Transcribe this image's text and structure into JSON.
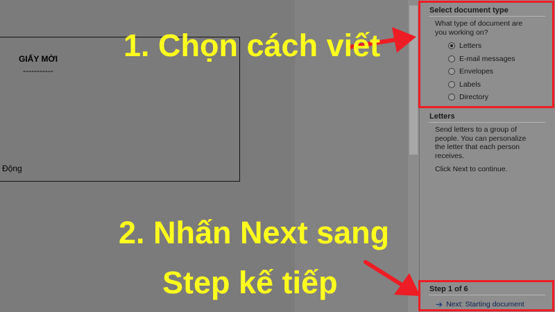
{
  "document": {
    "title": "GIẤY MỜI",
    "dashes": "-----------",
    "footer_fragment": "Động"
  },
  "pane": {
    "select_section": {
      "title": "Select document type",
      "question_line1": "What type of document are",
      "question_line2": "you working on?",
      "options": [
        {
          "label": "Letters",
          "checked": true
        },
        {
          "label": "E-mail messages",
          "checked": false
        },
        {
          "label": "Envelopes",
          "checked": false
        },
        {
          "label": "Labels",
          "checked": false
        },
        {
          "label": "Directory",
          "checked": false
        }
      ]
    },
    "letters_section": {
      "title": "Letters",
      "desc_line1": "Send letters to a group of",
      "desc_line2": "people. You can personalize",
      "desc_line3": "the letter that each person",
      "desc_line4": "receives.",
      "hint": "Click Next to continue."
    },
    "step_section": {
      "title": "Step 1 of 6",
      "next_label": "Next: Starting document"
    }
  },
  "annotations": {
    "step1": "1. Chọn cách viết",
    "step2_line1": "2. Nhấn Next sang",
    "step2_line2": "Step kế tiếp"
  },
  "colors": {
    "highlight": "#ee1c24",
    "annotation_text": "#ffff1e"
  }
}
